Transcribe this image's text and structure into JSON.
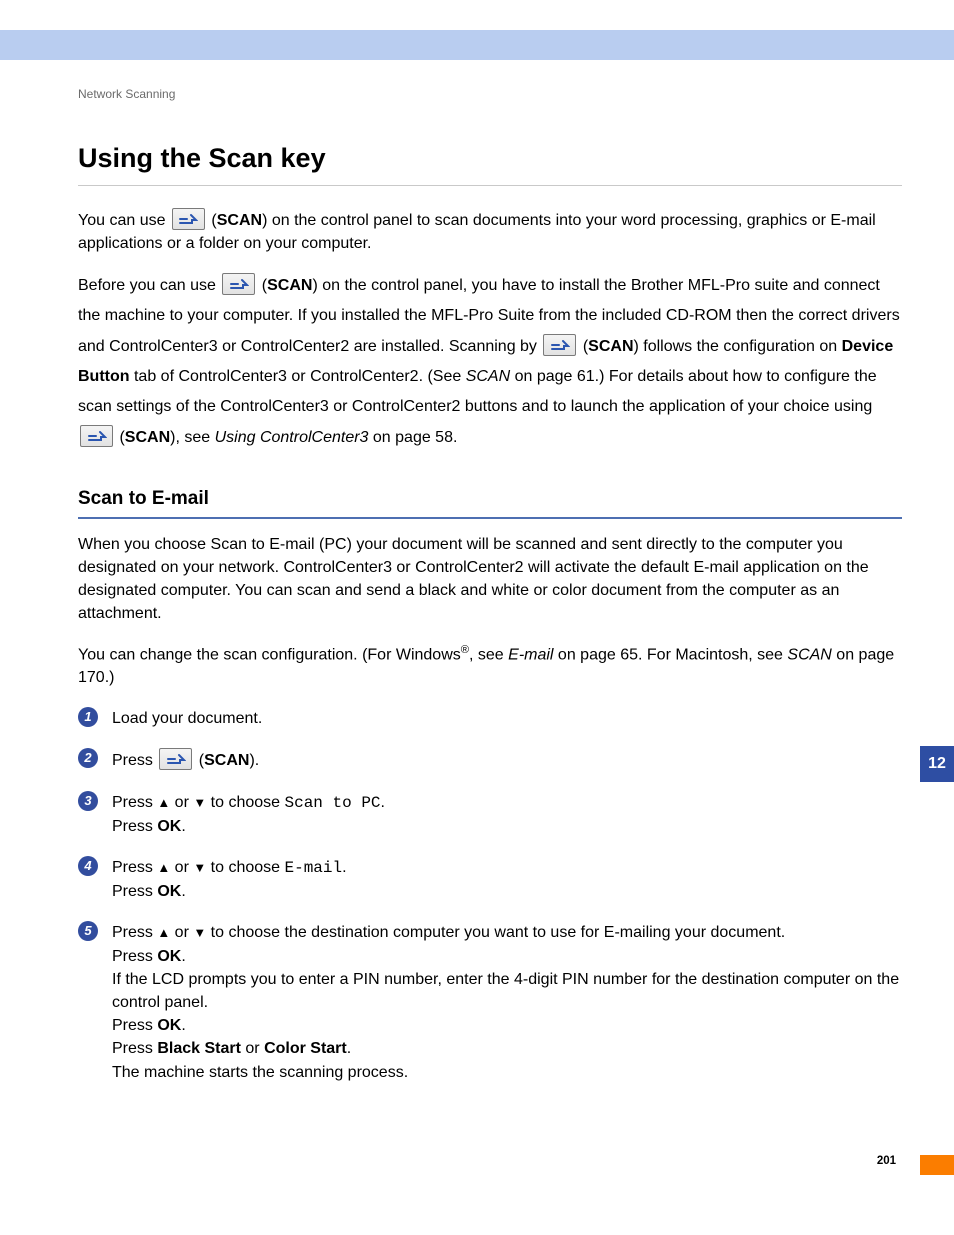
{
  "chapter_tab": "12",
  "page_number": "201",
  "running_header": "Network Scanning",
  "title": "Using the Scan key",
  "intro": {
    "pre1": "You can use ",
    "scan_label": "SCAN",
    "post1": ") on the control panel to scan documents into your word processing, graphics or E-mail applications or a folder on your computer."
  },
  "para2": {
    "a": "Before you can use ",
    "b": ") on the control panel, you have to install the Brother MFL-Pro suite and connect the machine to your computer. If you installed the MFL-Pro Suite from the included CD-ROM then the correct drivers and ControlCenter3 or ControlCenter2 are installed. Scanning by ",
    "c": ") follows the configuration on ",
    "device_button": "Device Button",
    "d": " tab of ControlCenter3 or ControlCenter2. (See ",
    "link1": "SCAN",
    "e": " on page 61.) For details about how to configure the scan settings of the ControlCenter3 or ControlCenter2 buttons and to launch the application of your choice using ",
    "f": "), see ",
    "link2": "Using ControlCenter3",
    "g": " on page 58."
  },
  "sub_heading": "Scan to E-mail",
  "scan_email_p1": "When you choose Scan to E-mail (PC) your document will be scanned and sent directly to the computer you designated on your network. ControlCenter3 or ControlCenter2 will activate the default E-mail application on the designated computer. You can scan and send a black and white or color document from the computer as an attachment.",
  "scan_email_p2": {
    "a": "You can change the scan configuration. (For Windows",
    "reg": "®",
    "b": ", see ",
    "link1": "E-mail",
    "c": " on page 65. For Macintosh, see ",
    "link2": "SCAN",
    "d": " on page 170.)"
  },
  "steps": [
    {
      "n": "1",
      "lines": [
        "Load your document."
      ]
    },
    {
      "n": "2",
      "press": "Press ",
      "scan": "SCAN",
      "end": ")."
    },
    {
      "n": "3",
      "l1a": "Press ",
      "l1b": " or ",
      "l1c": " to choose ",
      "mono": "Scan to PC",
      "l1d": ".",
      "l2a": "Press ",
      "ok": "OK",
      "l2b": "."
    },
    {
      "n": "4",
      "l1a": "Press ",
      "l1b": " or ",
      "l1c": " to choose ",
      "mono": "E-mail",
      "l1d": ".",
      "l2a": "Press ",
      "ok": "OK",
      "l2b": "."
    },
    {
      "n": "5",
      "l1a": "Press ",
      "l1b": " or ",
      "l1c": " to choose the destination computer you want to use for E-mailing your document.",
      "l2a": "Press ",
      "ok": "OK",
      "l2b": ".",
      "l3": "If the LCD prompts you to enter a PIN number, enter the 4-digit PIN number for the destination computer on the control panel.",
      "l4a": "Press ",
      "l4b": ".",
      "l5a": "Press ",
      "bs": "Black Start",
      "l5b": " or ",
      "cs": "Color Start",
      "l5c": ".",
      "l6": "The machine starts the scanning process."
    }
  ]
}
